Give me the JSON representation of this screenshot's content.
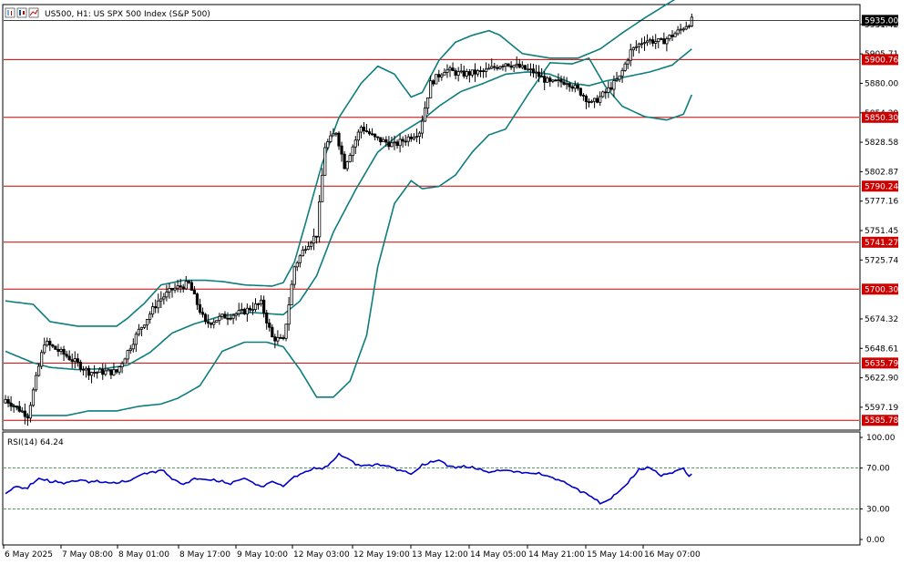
{
  "header": {
    "title": "US500, H1:  US SPX 500 Index (S&P 500)",
    "toolbar_icons": [
      "bar-chart-icon",
      "candlestick-icon",
      "line-chart-icon"
    ]
  },
  "colors": {
    "bull": "#000000",
    "bear": "#000000",
    "bands": "#0e7d7e",
    "levels": "#cc0000",
    "rsi": "#0000cc",
    "rsi_level": "#1e7a2e"
  },
  "price_axis": {
    "ticks": [
      "5931.42",
      "5905.71",
      "5880.00",
      "5854.29",
      "5828.58",
      "5802.87",
      "5777.16",
      "5751.45",
      "5725.74",
      "5674.32",
      "5648.61",
      "5622.90",
      "5597.19"
    ],
    "current": "5935.00"
  },
  "levels": [
    {
      "label": "5900.76",
      "value": 5900.76
    },
    {
      "label": "5850.30",
      "value": 5850.3
    },
    {
      "label": "5790.24",
      "value": 5790.24
    },
    {
      "label": "5741.27",
      "value": 5741.27
    },
    {
      "label": "5700.30",
      "value": 5700.3
    },
    {
      "label": "5635.79",
      "value": 5635.79
    },
    {
      "label": "5585.78",
      "value": 5585.78
    }
  ],
  "rsi": {
    "title": "RSI(14) 64.24",
    "axis_ticks": [
      "100.00",
      "70.00",
      "30.00",
      "0.00"
    ],
    "levels": [
      70,
      30
    ]
  },
  "x_axis": {
    "labels": [
      "6 May 2025",
      "7 May 08:00",
      "8 May 01:00",
      "8 May 17:00",
      "9 May 10:00",
      "12 May 03:00",
      "12 May 19:00",
      "13 May 12:00",
      "14 May 05:00",
      "14 May 21:00",
      "15 May 14:00",
      "16 May 07:00"
    ]
  },
  "chart_data": {
    "type": "candlestick",
    "title": "US500, H1:  US SPX 500 Index (S&P 500)",
    "x_labels": [
      "6 May 2025",
      "7 May 08:00",
      "8 May 01:00",
      "8 May 17:00",
      "9 May 10:00",
      "12 May 03:00",
      "12 May 19:00",
      "13 May 12:00",
      "14 May 05:00",
      "14 May 21:00",
      "15 May 14:00",
      "16 May 07:00"
    ],
    "ylim": [
      5578,
      5948
    ],
    "close_anchors": [
      [
        0,
        5604
      ],
      [
        8,
        5590
      ],
      [
        14,
        5654
      ],
      [
        22,
        5642
      ],
      [
        30,
        5628
      ],
      [
        40,
        5628
      ],
      [
        48,
        5664
      ],
      [
        55,
        5690
      ],
      [
        60,
        5700
      ],
      [
        66,
        5705
      ],
      [
        72,
        5670
      ],
      [
        78,
        5676
      ],
      [
        85,
        5680
      ],
      [
        92,
        5688
      ],
      [
        96,
        5658
      ],
      [
        100,
        5655
      ],
      [
        104,
        5720
      ],
      [
        108,
        5738
      ],
      [
        112,
        5748
      ],
      [
        115,
        5825
      ],
      [
        119,
        5838
      ],
      [
        122,
        5808
      ],
      [
        128,
        5842
      ],
      [
        133,
        5832
      ],
      [
        140,
        5826
      ],
      [
        149,
        5838
      ],
      [
        153,
        5880
      ],
      [
        158,
        5892
      ],
      [
        164,
        5888
      ],
      [
        172,
        5890
      ],
      [
        180,
        5898
      ],
      [
        190,
        5890
      ],
      [
        196,
        5880
      ],
      [
        202,
        5882
      ],
      [
        207,
        5872
      ],
      [
        211,
        5862
      ],
      [
        216,
        5872
      ],
      [
        221,
        5885
      ],
      [
        225,
        5908
      ],
      [
        230,
        5918
      ],
      [
        236,
        5916
      ],
      [
        242,
        5925
      ],
      [
        247,
        5935
      ]
    ],
    "bollinger": {
      "period": 20,
      "deviations": 2,
      "upper_anchors": [
        [
          0,
          5690
        ],
        [
          10,
          5687
        ],
        [
          16,
          5672
        ],
        [
          26,
          5668
        ],
        [
          40,
          5668
        ],
        [
          44,
          5675
        ],
        [
          50,
          5688
        ],
        [
          56,
          5704
        ],
        [
          64,
          5708
        ],
        [
          72,
          5708
        ],
        [
          78,
          5707
        ],
        [
          86,
          5704
        ],
        [
          96,
          5703
        ],
        [
          100,
          5706
        ],
        [
          104,
          5724
        ],
        [
          108,
          5758
        ],
        [
          114,
          5810
        ],
        [
          120,
          5850
        ],
        [
          128,
          5880
        ],
        [
          134,
          5895
        ],
        [
          140,
          5888
        ],
        [
          146,
          5868
        ],
        [
          150,
          5872
        ],
        [
          156,
          5900
        ],
        [
          162,
          5916
        ],
        [
          168,
          5922
        ],
        [
          174,
          5926
        ],
        [
          178,
          5922
        ],
        [
          186,
          5906
        ],
        [
          196,
          5902
        ],
        [
          206,
          5902
        ],
        [
          214,
          5910
        ],
        [
          222,
          5924
        ],
        [
          230,
          5937
        ],
        [
          240,
          5952
        ],
        [
          247,
          5962
        ]
      ],
      "middle_anchors": [
        [
          0,
          5646
        ],
        [
          10,
          5636
        ],
        [
          16,
          5632
        ],
        [
          26,
          5630
        ],
        [
          36,
          5631
        ],
        [
          44,
          5634
        ],
        [
          52,
          5645
        ],
        [
          60,
          5662
        ],
        [
          68,
          5670
        ],
        [
          78,
          5677
        ],
        [
          88,
          5680
        ],
        [
          94,
          5679
        ],
        [
          100,
          5678
        ],
        [
          106,
          5690
        ],
        [
          112,
          5712
        ],
        [
          118,
          5750
        ],
        [
          126,
          5787
        ],
        [
          134,
          5820
        ],
        [
          142,
          5836
        ],
        [
          150,
          5848
        ],
        [
          156,
          5860
        ],
        [
          164,
          5873
        ],
        [
          172,
          5880
        ],
        [
          180,
          5888
        ],
        [
          188,
          5890
        ],
        [
          196,
          5888
        ],
        [
          204,
          5880
        ],
        [
          210,
          5878
        ],
        [
          216,
          5882
        ],
        [
          224,
          5886
        ],
        [
          232,
          5890
        ],
        [
          240,
          5896
        ],
        [
          247,
          5910
        ]
      ],
      "lower_anchors": [
        [
          0,
          5604
        ],
        [
          8,
          5590
        ],
        [
          14,
          5590
        ],
        [
          22,
          5590
        ],
        [
          30,
          5594
        ],
        [
          40,
          5594
        ],
        [
          48,
          5598
        ],
        [
          56,
          5600
        ],
        [
          62,
          5605
        ],
        [
          70,
          5616
        ],
        [
          78,
          5646
        ],
        [
          86,
          5654
        ],
        [
          94,
          5654
        ],
        [
          100,
          5650
        ],
        [
          106,
          5630
        ],
        [
          112,
          5606
        ],
        [
          118,
          5606
        ],
        [
          124,
          5620
        ],
        [
          130,
          5660
        ],
        [
          134,
          5720
        ],
        [
          140,
          5775
        ],
        [
          146,
          5795
        ],
        [
          150,
          5788
        ],
        [
          156,
          5790
        ],
        [
          162,
          5800
        ],
        [
          168,
          5820
        ],
        [
          174,
          5835
        ],
        [
          180,
          5840
        ],
        [
          188,
          5870
        ],
        [
          196,
          5898
        ],
        [
          204,
          5897
        ],
        [
          210,
          5902
        ],
        [
          216,
          5877
        ],
        [
          222,
          5860
        ],
        [
          230,
          5851
        ],
        [
          238,
          5848
        ],
        [
          244,
          5853
        ],
        [
          247,
          5870
        ]
      ]
    },
    "rsi": {
      "period": 14,
      "last_value": 64.24,
      "ylim": [
        0,
        100
      ],
      "levels": [
        70,
        30
      ],
      "anchors": [
        [
          0,
          45
        ],
        [
          4,
          52
        ],
        [
          8,
          50
        ],
        [
          12,
          60
        ],
        [
          16,
          56
        ],
        [
          22,
          56
        ],
        [
          28,
          58
        ],
        [
          34,
          56
        ],
        [
          40,
          55
        ],
        [
          44,
          57
        ],
        [
          50,
          65
        ],
        [
          56,
          68
        ],
        [
          60,
          60
        ],
        [
          64,
          54
        ],
        [
          68,
          60
        ],
        [
          74,
          58
        ],
        [
          80,
          55
        ],
        [
          86,
          60
        ],
        [
          92,
          52
        ],
        [
          96,
          57
        ],
        [
          100,
          52
        ],
        [
          104,
          62
        ],
        [
          110,
          68
        ],
        [
          116,
          72
        ],
        [
          120,
          83
        ],
        [
          124,
          78
        ],
        [
          128,
          72
        ],
        [
          134,
          74
        ],
        [
          140,
          70
        ],
        [
          146,
          64
        ],
        [
          150,
          72
        ],
        [
          156,
          78
        ],
        [
          160,
          72
        ],
        [
          168,
          70
        ],
        [
          174,
          66
        ],
        [
          180,
          68
        ],
        [
          186,
          66
        ],
        [
          192,
          64
        ],
        [
          198,
          60
        ],
        [
          204,
          52
        ],
        [
          210,
          44
        ],
        [
          214,
          35
        ],
        [
          218,
          40
        ],
        [
          224,
          55
        ],
        [
          228,
          68
        ],
        [
          232,
          70
        ],
        [
          236,
          62
        ],
        [
          240,
          66
        ],
        [
          244,
          70
        ],
        [
          246,
          60
        ],
        [
          247,
          64.24
        ]
      ]
    },
    "horizontal_levels": [
      5900.76,
      5850.3,
      5790.24,
      5741.27,
      5700.3,
      5635.79,
      5585.78
    ],
    "grid": false,
    "legend": "none"
  }
}
